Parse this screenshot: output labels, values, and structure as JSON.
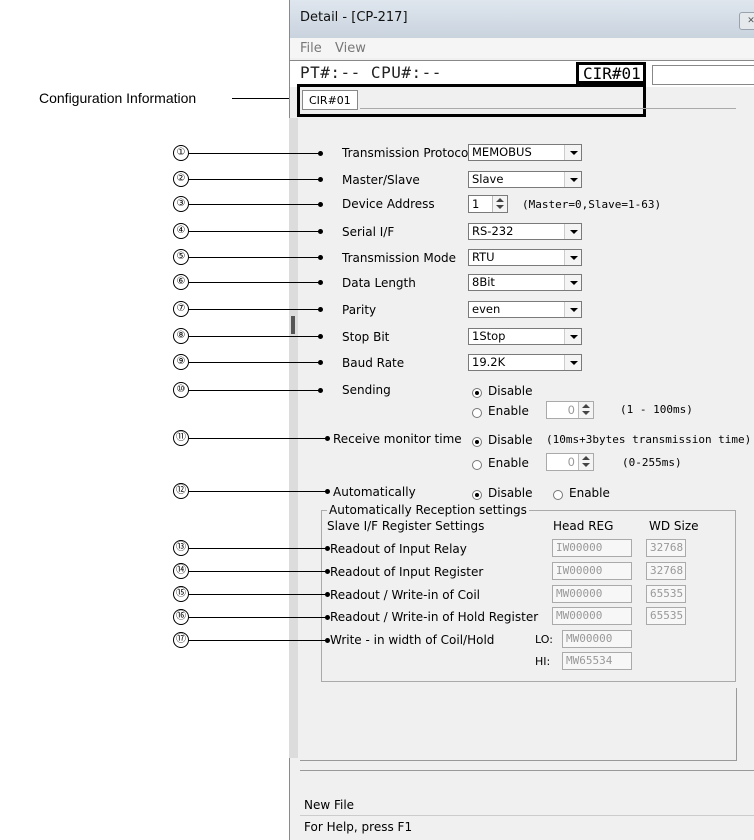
{
  "window": {
    "title": "Detail - [CP-217]",
    "menu": [
      "File",
      "View"
    ],
    "info": {
      "pt_cpu": "PT#:-- CPU#:--",
      "cir": "CIR#01"
    },
    "tab": "CIR#01",
    "status": [
      "New File",
      "For Help, press F1"
    ]
  },
  "annotation": {
    "config_label": "Configuration Information"
  },
  "callouts": [
    "①",
    "②",
    "③",
    "④",
    "⑤",
    "⑥",
    "⑦",
    "⑧",
    "⑨",
    "⑩",
    "⑪",
    "⑫",
    "⑬",
    "⑭",
    "⑮",
    "⑯",
    "⑰"
  ],
  "form": {
    "transmission_protocol": {
      "label": "Transmission Protocol",
      "value": "MEMOBUS"
    },
    "master_slave": {
      "label": "Master/Slave",
      "value": "Slave"
    },
    "device_address": {
      "label": "Device Address",
      "value": "1",
      "hint": "(Master=0,Slave=1-63)"
    },
    "serial_if": {
      "label": "Serial I/F",
      "value": "RS-232"
    },
    "transmission_mode": {
      "label": "Transmission Mode",
      "value": "RTU"
    },
    "data_length": {
      "label": "Data Length",
      "value": "8Bit"
    },
    "parity": {
      "label": "Parity",
      "value": "even"
    },
    "stop_bit": {
      "label": "Stop Bit",
      "value": "1Stop"
    },
    "baud_rate": {
      "label": "Baud Rate",
      "value": "19.2K"
    },
    "sending": {
      "label": "Sending",
      "disable": "Disable",
      "enable": "Enable",
      "value": "0",
      "range": "(1 - 100ms)"
    },
    "receive_monitor": {
      "label": "Receive monitor time",
      "disable": "Disable",
      "disable_hint": "(10ms+3bytes transmission time)",
      "enable": "Enable",
      "value": "0",
      "range": "(0-255ms)"
    },
    "automatically": {
      "label": "Automatically",
      "disable": "Disable",
      "enable": "Enable"
    }
  },
  "reception": {
    "group_title": "Automatically Reception settings",
    "header": "Slave I/F Register Settings",
    "col_head": "Head REG",
    "col_size": "WD Size",
    "rows": [
      {
        "label": "Readout of Input Relay",
        "head": "IW00000",
        "size": "32768"
      },
      {
        "label": "Readout of Input Register",
        "head": "IW00000",
        "size": "32768"
      },
      {
        "label": "Readout / Write-in of Coil",
        "head": "MW00000",
        "size": "65535"
      },
      {
        "label": "Readout / Write-in of Hold Register",
        "head": "MW00000",
        "size": "65535"
      }
    ],
    "write_width": {
      "label": "Write - in width of Coil/Hold",
      "lo_label": "LO:",
      "lo": "MW00000",
      "hi_label": "HI:",
      "hi": "MW65534"
    }
  }
}
